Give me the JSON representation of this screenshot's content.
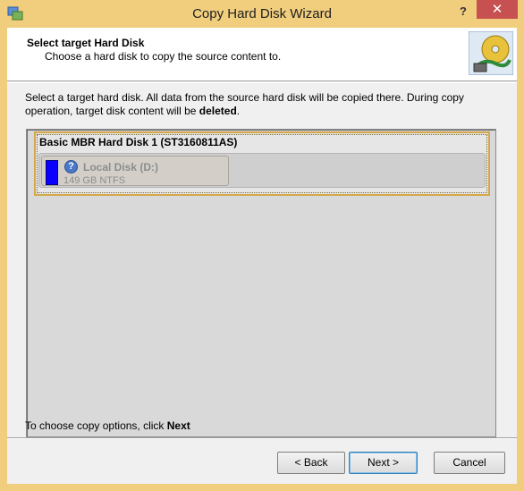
{
  "window": {
    "title": "Copy Hard Disk Wizard",
    "help_label": "?",
    "close_label": "✕",
    "accent_color": "#f0ce7e"
  },
  "header": {
    "title": "Select target Hard Disk",
    "subtitle": "Choose a hard disk to copy the source content to."
  },
  "instruction": {
    "text": "Select a target hard disk. All data from the source hard disk will be copied there. During copy operation, target disk content will be ",
    "emphasis": "deleted",
    "suffix": "."
  },
  "disks": [
    {
      "name": "Basic MBR Hard Disk 1 (ST3160811AS)",
      "partitions": [
        {
          "label": "Local Disk (D:)",
          "details": "149 GB NTFS",
          "icon": "question-icon",
          "usage_color": "#0a00ff"
        }
      ]
    }
  ],
  "footer": {
    "hint_text": "To choose copy options, click ",
    "hint_emphasis": "Next"
  },
  "buttons": {
    "back": "< Back",
    "next": "Next >",
    "cancel": "Cancel"
  }
}
